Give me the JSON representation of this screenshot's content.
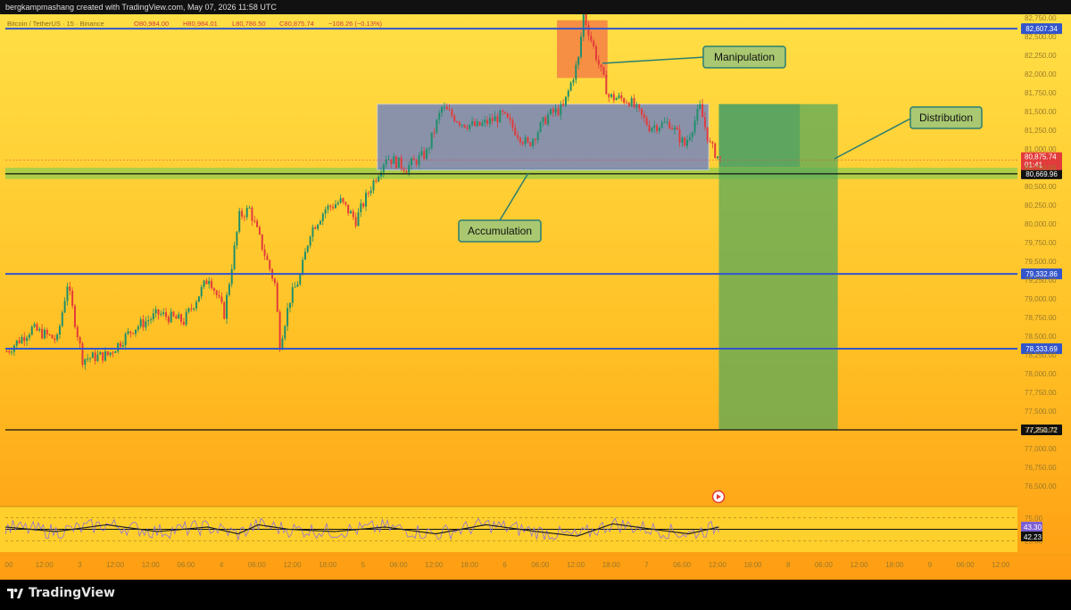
{
  "header": {
    "credit": "bergkampmashang created with TradingView.com, May 07, 2026 11:58 UTC"
  },
  "legend": {
    "symbol": "Bitcoin / TetherUS · 15 · Binance",
    "open": "O80,984.00",
    "high": "H80,984.01",
    "low": "L80,786.50",
    "close": "C80,875.74",
    "change": "−108.26 (−0.13%)"
  },
  "brand": {
    "name": "TradingView"
  },
  "colors": {
    "bg_top": "#ffd93a",
    "bg_bottom": "#ffa114",
    "candle_up": "#1f8f6b",
    "candle_down": "#e23b3b",
    "level_line": "#3355cc",
    "accumulation_box": "#6d82c6",
    "manipulation_box": "#f47a45",
    "distribution_box": "#59a85a",
    "support_zone": "#9dcc4a",
    "label_bg": "#a9c871"
  },
  "chart_data": {
    "type": "line",
    "title": "Bitcoin / TetherUS · 15 · Binance",
    "y_axis_range": [
      76250,
      82800
    ],
    "y_ticks": [
      "82,750.00",
      "82,500.00",
      "82,250.00",
      "82,000.00",
      "81,750.00",
      "81,500.00",
      "81,250.00",
      "81,000.00",
      "80,750.00",
      "80,500.00",
      "80,250.00",
      "80,000.00",
      "79,750.00",
      "79,500.00",
      "79,250.00",
      "79,000.00",
      "78,750.00",
      "78,500.00",
      "78,250.00",
      "78,000.00",
      "77,750.00",
      "77,500.00",
      "77,250.00",
      "77,000.00",
      "76,750.00",
      "76,500.00"
    ],
    "x_ticks": [
      {
        "label": "00",
        "i": 0
      },
      {
        "label": "12:00",
        "i": 14
      },
      {
        "label": "3",
        "i": 28
      },
      {
        "label": "12:00",
        "i": 42
      },
      {
        "label": "12:00",
        "i": 56
      },
      {
        "label": "06:00",
        "i": 70
      },
      {
        "label": "4",
        "i": 84
      },
      {
        "label": "06:00",
        "i": 98
      },
      {
        "label": "12:00",
        "i": 112
      },
      {
        "label": "18:00",
        "i": 126
      },
      {
        "label": "5",
        "i": 140
      },
      {
        "label": "06:00",
        "i": 154
      },
      {
        "label": "12:00",
        "i": 168
      },
      {
        "label": "18:00",
        "i": 182
      },
      {
        "label": "6",
        "i": 196
      },
      {
        "label": "06:00",
        "i": 210
      },
      {
        "label": "12:00",
        "i": 224
      },
      {
        "label": "18:00",
        "i": 238
      },
      {
        "label": "7",
        "i": 252
      },
      {
        "label": "06:00",
        "i": 266
      },
      {
        "label": "12:00",
        "i": 280
      },
      {
        "label": "18:00",
        "i": 294
      },
      {
        "label": "8",
        "i": 308
      },
      {
        "label": "06:00",
        "i": 322
      },
      {
        "label": "12:00",
        "i": 336
      },
      {
        "label": "18:00",
        "i": 350
      },
      {
        "label": "9",
        "i": 364
      },
      {
        "label": "06:00",
        "i": 378
      },
      {
        "label": "12:00",
        "i": 392
      }
    ],
    "bar_count": 400,
    "series": [
      {
        "points": [
          [
            0,
            78300
          ],
          [
            10,
            78600
          ],
          [
            20,
            78450
          ],
          [
            24,
            79200
          ],
          [
            30,
            78200
          ],
          [
            40,
            78250
          ],
          [
            50,
            78600
          ],
          [
            60,
            78800
          ],
          [
            70,
            78700
          ],
          [
            80,
            79300
          ],
          [
            86,
            78800
          ],
          [
            92,
            80100
          ],
          [
            96,
            80200
          ],
          [
            100,
            79800
          ],
          [
            106,
            79200
          ],
          [
            108,
            78400
          ],
          [
            112,
            79000
          ],
          [
            116,
            79300
          ],
          [
            120,
            79900
          ],
          [
            126,
            80200
          ],
          [
            132,
            80300
          ],
          [
            138,
            80050
          ],
          [
            144,
            80500
          ],
          [
            150,
            80900
          ],
          [
            158,
            80750
          ],
          [
            166,
            80950
          ],
          [
            172,
            81550
          ],
          [
            180,
            81350
          ],
          [
            186,
            81300
          ],
          [
            196,
            81450
          ],
          [
            206,
            81050
          ],
          [
            214,
            81450
          ],
          [
            220,
            81550
          ],
          [
            226,
            82200
          ],
          [
            228,
            82800
          ],
          [
            232,
            82350
          ],
          [
            238,
            81700
          ],
          [
            246,
            81650
          ],
          [
            254,
            81300
          ],
          [
            262,
            81350
          ],
          [
            268,
            81050
          ],
          [
            274,
            81550
          ],
          [
            278,
            81050
          ],
          [
            282,
            80850
          ]
        ]
      },
      {
        "points": [
          [
            0,
            0.55
          ],
          [
            20,
            0.45
          ],
          [
            40,
            0.6
          ],
          [
            60,
            0.45
          ],
          [
            80,
            0.55
          ],
          [
            92,
            0.4
          ],
          [
            100,
            0.6
          ],
          [
            112,
            0.5
          ],
          [
            130,
            0.45
          ],
          [
            150,
            0.55
          ],
          [
            170,
            0.4
          ],
          [
            190,
            0.6
          ],
          [
            210,
            0.45
          ],
          [
            226,
            0.35
          ],
          [
            240,
            0.62
          ],
          [
            256,
            0.5
          ],
          [
            270,
            0.4
          ],
          [
            282,
            0.55
          ]
        ]
      }
    ],
    "levels": [
      {
        "label": "82,607.34",
        "value": 82607.34,
        "style": "blue"
      },
      {
        "label": "80,669.96",
        "value": 80669.96,
        "style": "black"
      },
      {
        "label": "79,332.86",
        "value": 79332.86,
        "style": "blue"
      },
      {
        "label": "78,333.69",
        "value": 78333.69,
        "style": "blue"
      },
      {
        "label": "77,250.72",
        "value": 77250.72,
        "style": "black"
      }
    ],
    "last_price": {
      "label": "80,875.74",
      "countdown": "01:41"
    },
    "zones": [
      {
        "name": "Accumulation",
        "from_i": 147,
        "to_i": 278,
        "low": 80720,
        "high": 81600
      },
      {
        "name": "Manipulation",
        "from_i": 218,
        "to_i": 238,
        "low": 81950,
        "high": 82720
      },
      {
        "name": "Distribution",
        "from_i": 282,
        "to_i": 329,
        "low": 77250,
        "high": 81600
      }
    ],
    "support_zone": {
      "low": 80600,
      "high": 80750
    },
    "annotations": [
      {
        "text": "Manipulation"
      },
      {
        "text": "Accumulation"
      },
      {
        "text": "Distribution"
      }
    ],
    "oscillator": {
      "values": [
        0.55,
        0.45,
        0.6,
        0.45
      ],
      "ticks": [
        "75.00",
        "50.00",
        "25.00"
      ],
      "readouts": [
        "43.30",
        "42.23"
      ]
    }
  }
}
